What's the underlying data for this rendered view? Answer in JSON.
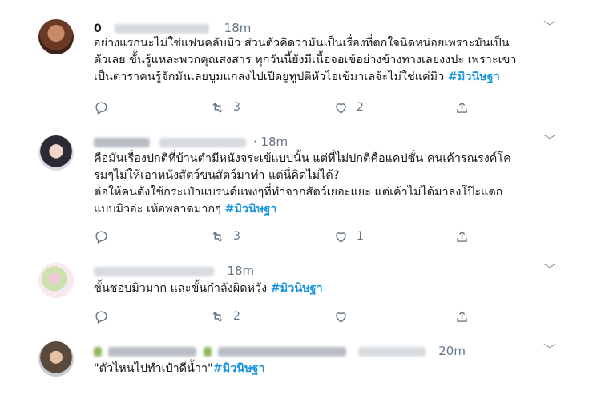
{
  "tweets": [
    {
      "name": "0",
      "time": "18m",
      "text": "อย่างแรกนะไม่ใช่แฟนคลับมิว ส่วนตัวคิดว่ามันเป็นเรื่องที่ตกใจนิดหน่อยเพราะมันเป็น\nตัวเลย ขั้นรู้แหละพวกคุณสงสาร ทุกวันนี้ยังมีเนื้อจอเข้อย่างข้างทางเลยงงปะ เพราะเขา\nเป็นตาราคนรู้จักมันเลยบูมแกลงไปเปิดยูทูปติหัวไอเข้มาเลจ้ะไม่ใช่แค่มิว",
      "hashtag": "#มิวนิษฐา",
      "reply_count": "",
      "retweet_count": "3",
      "like_count": "2"
    },
    {
      "name": "",
      "time": "· 18m",
      "text": "คือมันเรื่องปกติที่บ้านตำมีหนังจระเข้แบบนั้น แต่ที่ไม่ปกติคือแคปชั่น คนเค้ารณรงค์โค\nรมๆไม่ให้เอาหนังสัตว์ขนสัตว์มาทำ แต่นี่คิดไม่ได้?\nต่อให้คนดังใช้กระเป๋าแบรนด์แพงๆที่ทำจากสัตว์เยอะแยะ แต่เค้าไม่ได้มาลงโป๊ะแตก\nแบบมิวอ่ะ เห้อพลาดมากๆ",
      "hashtag": "#มิวนิษฐา",
      "reply_count": "",
      "retweet_count": "3",
      "like_count": "1"
    },
    {
      "name": "",
      "time": "18m",
      "text": "ขั้นชอบมิวมาก และขั้นกำลังผิดหวัง",
      "hashtag": "#มิวนิษฐา",
      "reply_count": "",
      "retweet_count": "2",
      "like_count": ""
    },
    {
      "name": "",
      "time": "20m",
      "text": "\"ตัวไหนไปทำเป๋าดีน้ำา\"",
      "hashtag": "#มิวนิษฐา",
      "reply_count": "",
      "retweet_count": "",
      "like_count": ""
    }
  ],
  "icons": {
    "reply": "reply-icon",
    "retweet": "retweet-icon",
    "like": "heart-icon",
    "share": "share-icon",
    "more": "chevron-down-icon"
  },
  "colors": {
    "hashtag": "#1b95e0",
    "secondary": "#657786",
    "divider": "#e6ecf0"
  }
}
